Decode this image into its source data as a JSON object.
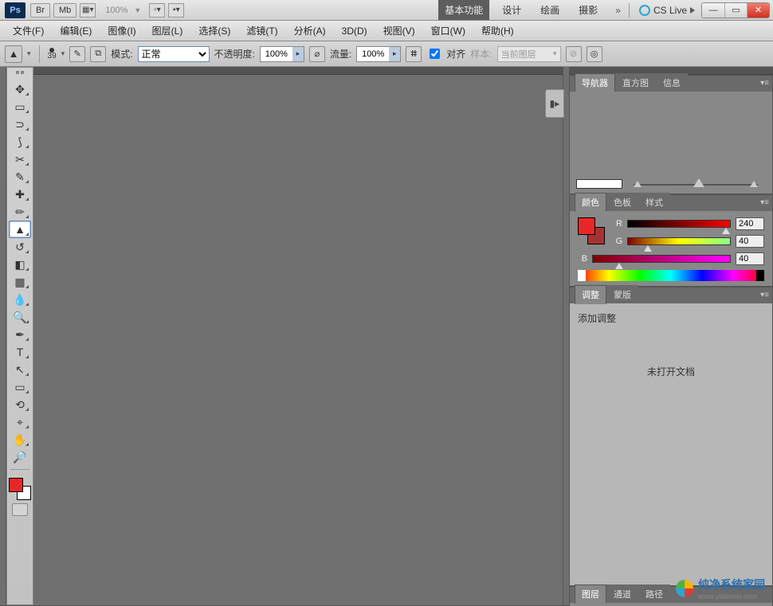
{
  "titlebar": {
    "logo": "Ps",
    "btn_br": "Br",
    "btn_mb": "Mb",
    "zoom": "100%",
    "workspace_tabs": [
      "基本功能",
      "设计",
      "绘画",
      "摄影"
    ],
    "active_ws": 0,
    "cslive": "CS Live"
  },
  "menubar": {
    "items": [
      "文件(F)",
      "编辑(E)",
      "图像(I)",
      "图层(L)",
      "选择(S)",
      "滤镜(T)",
      "分析(A)",
      "3D(D)",
      "视图(V)",
      "窗口(W)",
      "帮助(H)"
    ]
  },
  "optbar": {
    "brush_size": "39",
    "mode_label": "模式:",
    "mode_value": "正常",
    "opacity_label": "不透明度:",
    "opacity_value": "100%",
    "flow_label": "流量:",
    "flow_value": "100%",
    "align_label": "对齐",
    "sample_label": "样本:",
    "sample_value": "当前图层"
  },
  "panels": {
    "nav": {
      "tabs": [
        "导航器",
        "直方图",
        "信息"
      ],
      "active": 0
    },
    "color": {
      "tabs": [
        "颜色",
        "色板",
        "样式"
      ],
      "active": 0,
      "channels": [
        {
          "label": "R",
          "value": "240",
          "pos": 92
        },
        {
          "label": "G",
          "value": "40",
          "pos": 16
        },
        {
          "label": "B",
          "value": "40",
          "pos": 16
        }
      ],
      "fg": "#e82828",
      "bg": "#a63333"
    },
    "adjust": {
      "tabs": [
        "调整",
        "蒙版"
      ],
      "active": 0,
      "add_label": "添加调整",
      "empty_label": "未打开文档"
    },
    "bottom": {
      "tabs": [
        "图层",
        "通道",
        "路径"
      ],
      "active": 0
    }
  },
  "watermark": {
    "title": "纯净系统家园",
    "url": "www.yidaimei.com"
  }
}
